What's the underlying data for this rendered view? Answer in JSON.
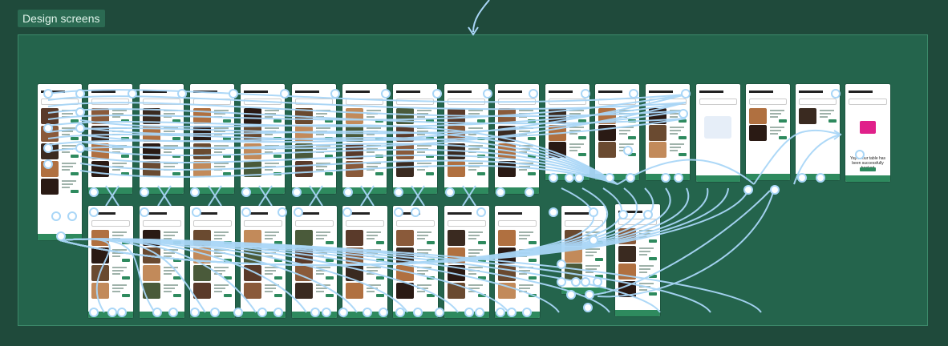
{
  "section_label": "Design screens",
  "confirmation_text": "Yay!! Your table has been successfully booked",
  "colors": {
    "background": "#1f4a3b",
    "section": "#24644c",
    "wire": "#a9d6f7",
    "accent": "#2e8a5e"
  }
}
